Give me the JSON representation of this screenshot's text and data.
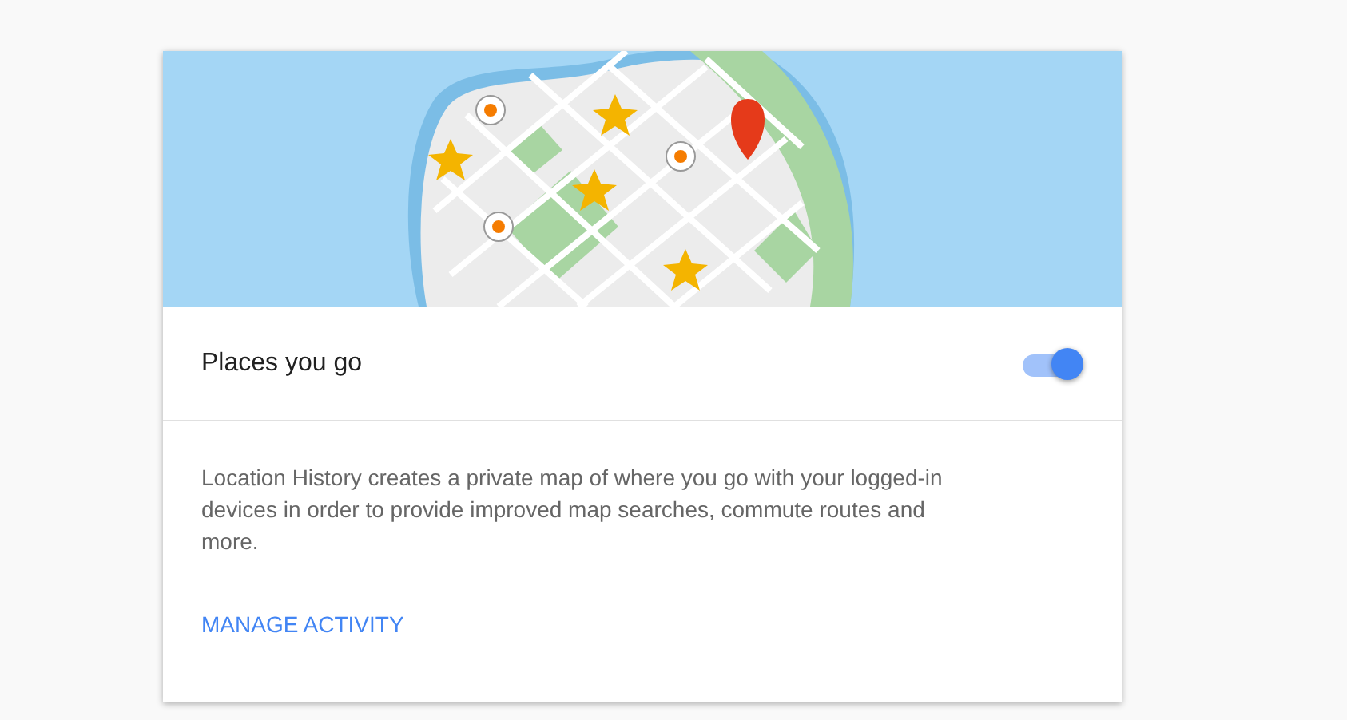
{
  "setting": {
    "label": "Places you go",
    "on": true
  },
  "description": "Location History creates a private map of where you go with your logged-in devices in order to provide improved map searches, commute routes and more.",
  "link": "MANAGE ACTIVITY"
}
